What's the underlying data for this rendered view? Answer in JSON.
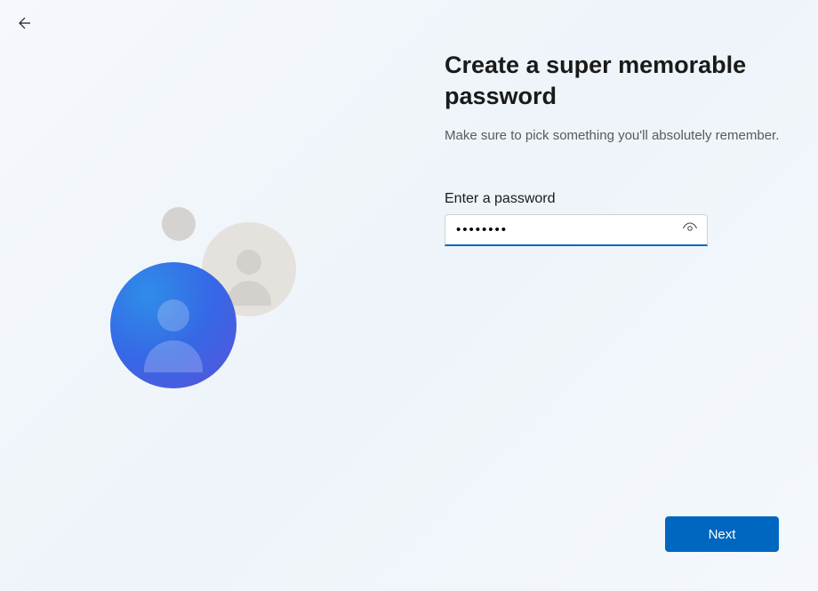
{
  "header": {
    "title": "Create a super memorable password",
    "subtitle": "Make sure to pick something you'll absolutely remember."
  },
  "form": {
    "password_label": "Enter a password",
    "password_value": "••••••••"
  },
  "actions": {
    "next_label": "Next"
  },
  "colors": {
    "accent": "#0067c0"
  }
}
